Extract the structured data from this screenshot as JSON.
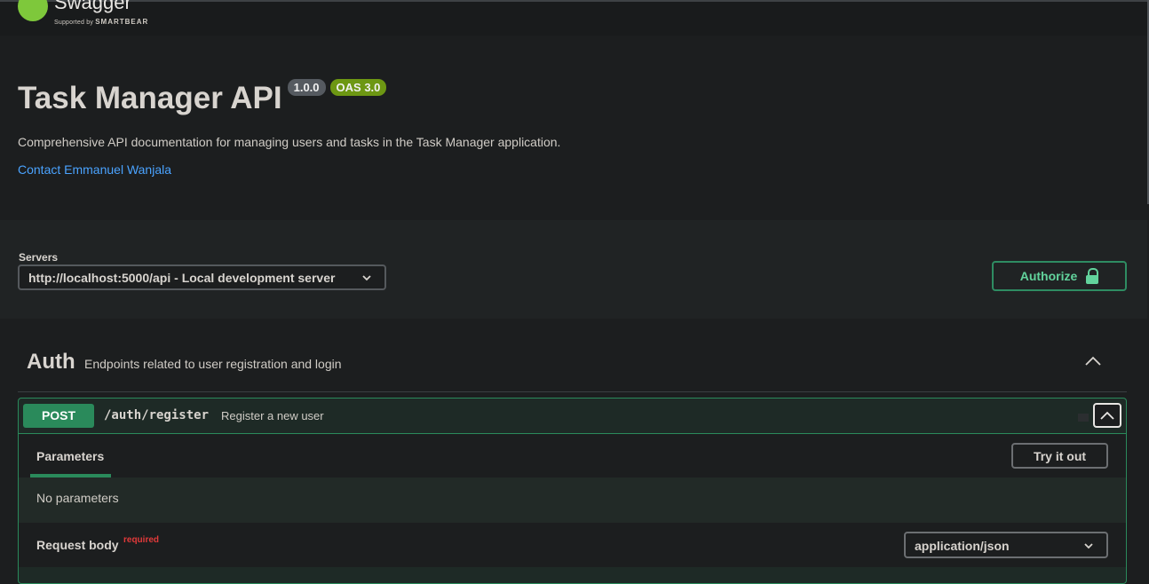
{
  "header": {
    "logo_word": "Swagger",
    "logo_sub_prefix": "Supported by",
    "logo_sub_brand": "SMARTBEAR",
    "logo_color": "#7ec83b"
  },
  "info": {
    "title": "Task Manager API",
    "version_badge": "1.0.0",
    "oas_badge": "OAS 3.0",
    "description": "Comprehensive API documentation for managing users and tasks in the Task Manager application.",
    "contact_link": "Contact Emmanuel Wanjala"
  },
  "servers": {
    "label": "Servers",
    "selected": "http://localhost:5000/api - Local development server",
    "authorize_label": "Authorize"
  },
  "tag": {
    "name": "Auth",
    "description": "Endpoints related to user registration and login"
  },
  "operation": {
    "method": "POST",
    "path": "/auth/register",
    "summary": "Register a new user",
    "method_color": "#2a8a5b",
    "parameters_tab": "Parameters",
    "try_it_out": "Try it out",
    "no_parameters": "No parameters",
    "request_body_label": "Request body",
    "required_label": "required",
    "content_type": "application/json"
  }
}
